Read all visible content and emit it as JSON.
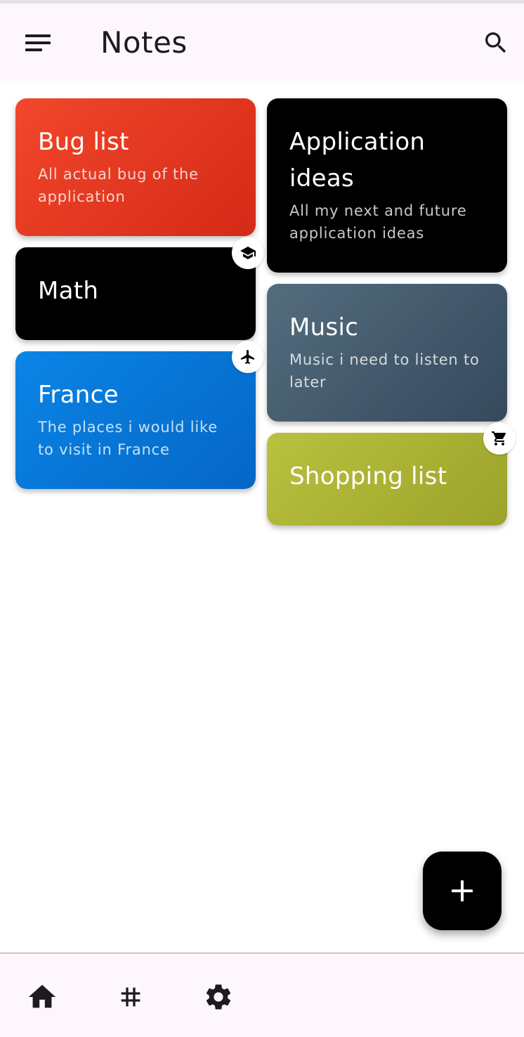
{
  "appbar": {
    "title": "Notes",
    "menu_icon": "sort-menu-icon",
    "search_icon": "search-icon"
  },
  "notes": [
    {
      "title": "Bug list",
      "description": "All actual bug of the application",
      "color": "#E03A1F",
      "icon": null
    },
    {
      "title": "Math",
      "description": "",
      "color": "#000000",
      "icon": "school-icon"
    },
    {
      "title": "France",
      "description": "The places i would like to visit in France",
      "color": "#0577D9",
      "icon": "airplane-icon"
    },
    {
      "title": "Application ideas",
      "description": "All my next and future application ideas",
      "color": "#000000",
      "icon": null
    },
    {
      "title": "Music",
      "description": "Music i need to listen to later",
      "color": "#455A6C",
      "icon": null
    },
    {
      "title": "Shopping list",
      "description": "",
      "color": "#ABB236",
      "icon": "shopping-cart-icon"
    }
  ],
  "fab": {
    "icon": "add-icon"
  },
  "bottom_nav": [
    {
      "name": "home",
      "icon": "home-icon"
    },
    {
      "name": "tags",
      "icon": "hashtag-icon"
    },
    {
      "name": "settings",
      "icon": "gear-icon"
    }
  ]
}
